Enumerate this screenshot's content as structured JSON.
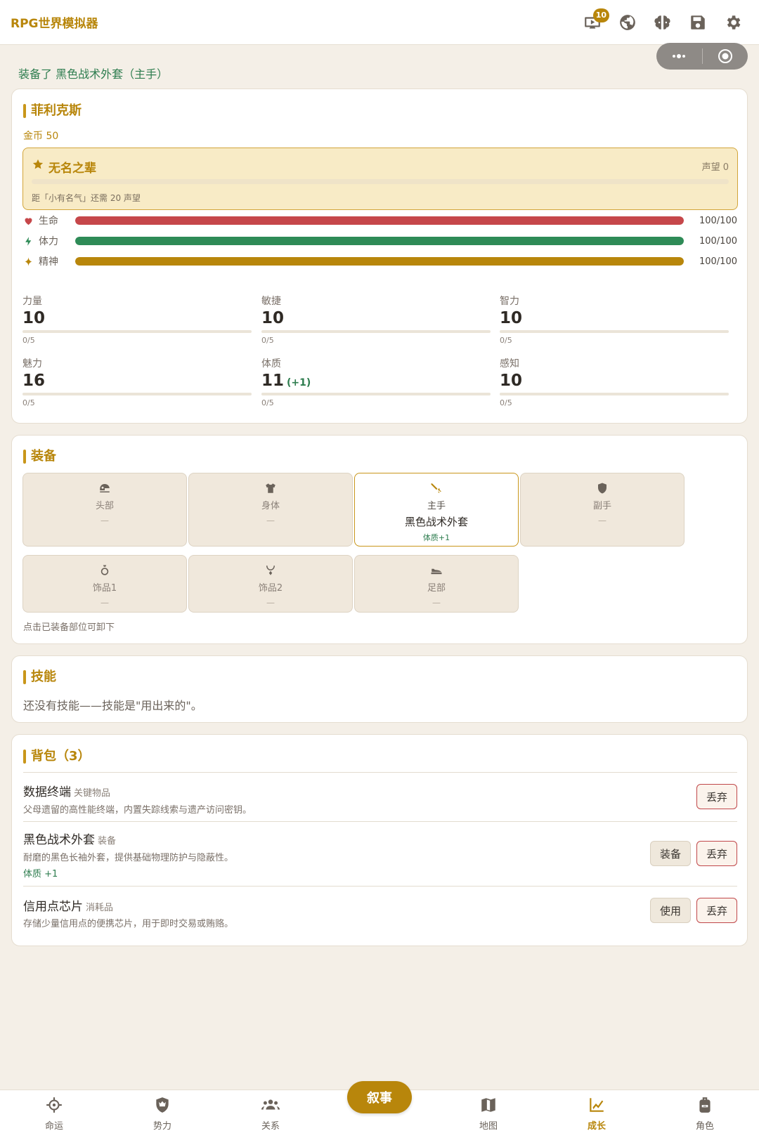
{
  "header": {
    "title": "RPG世界模拟器",
    "notification_count": "10",
    "icons": [
      "tv-icon",
      "globe-icon",
      "brain-icon",
      "save-icon",
      "gear-icon"
    ]
  },
  "notice": "装备了 黑色战术外套（主手）",
  "character": {
    "name": "菲利克斯",
    "gold": "金币 50",
    "fame": {
      "title": "无名之辈",
      "value": "声望 0",
      "progress": 0,
      "hint": "距「小有名气」还需 20 声望"
    },
    "vitals": [
      {
        "label": "生命",
        "value": "100/100",
        "fraction": 1.0,
        "color": "#c6474a",
        "icon": "heart-icon"
      },
      {
        "label": "体力",
        "value": "100/100",
        "fraction": 1.0,
        "color": "#2e8b57",
        "icon": "bolt-icon"
      },
      {
        "label": "精神",
        "value": "100/100",
        "fraction": 1.0,
        "color": "#b8860b",
        "icon": "sparkle-icon"
      }
    ],
    "stats": [
      {
        "label": "力量",
        "value": "10",
        "bonus": "",
        "progress": "0/5",
        "fraction": 0
      },
      {
        "label": "敏捷",
        "value": "10",
        "bonus": "",
        "progress": "0/5",
        "fraction": 0
      },
      {
        "label": "智力",
        "value": "10",
        "bonus": "",
        "progress": "0/5",
        "fraction": 0
      },
      {
        "label": "魅力",
        "value": "16",
        "bonus": "",
        "progress": "0/5",
        "fraction": 0
      },
      {
        "label": "体质",
        "value": "11",
        "bonus": "(+1)",
        "progress": "0/5",
        "fraction": 0
      },
      {
        "label": "感知",
        "value": "10",
        "bonus": "",
        "progress": "0/5",
        "fraction": 0
      }
    ]
  },
  "equipment": {
    "title": "装备",
    "hint": "点击已装备部位可卸下",
    "slots": [
      {
        "name": "头部",
        "item": "—",
        "bonus": "",
        "icon": "helmet-icon"
      },
      {
        "name": "身体",
        "item": "—",
        "bonus": "",
        "icon": "shirt-icon"
      },
      {
        "name": "主手",
        "item": "黑色战术外套",
        "bonus": "体质+1",
        "icon": "sword-icon"
      },
      {
        "name": "副手",
        "item": "—",
        "bonus": "",
        "icon": "shield-icon"
      },
      {
        "name": "饰品1",
        "item": "—",
        "bonus": "",
        "icon": "ring-icon"
      },
      {
        "name": "饰品2",
        "item": "—",
        "bonus": "",
        "icon": "necklace-icon"
      },
      {
        "name": "足部",
        "item": "—",
        "bonus": "",
        "icon": "shoe-icon"
      }
    ]
  },
  "skills": {
    "title": "技能",
    "empty": "还没有技能——技能是\"用出来的\"。"
  },
  "inventory": {
    "title": "背包（3）",
    "items": [
      {
        "name": "数据终端",
        "type": "关键物品",
        "desc": "父母遗留的高性能终端，内置失踪线索与遗产访问密钥。",
        "bonus": "",
        "actions": [
          "丢弃"
        ]
      },
      {
        "name": "黑色战术外套",
        "type": "装备",
        "desc": "耐磨的黑色长袖外套，提供基础物理防护与隐蔽性。",
        "bonus": "体质 +1",
        "actions": [
          "装备",
          "丢弃"
        ]
      },
      {
        "name": "信用点芯片",
        "type": "消耗品",
        "desc": "存储少量信用点的便携芯片，用于即时交易或贿赂。",
        "bonus": "",
        "actions": [
          "使用",
          "丢弃"
        ]
      }
    ]
  },
  "nav": {
    "center_label": "叙事",
    "active": "成长",
    "items": [
      {
        "label": "命运",
        "icon": "crosshair-icon"
      },
      {
        "label": "势力",
        "icon": "crown-shield-icon"
      },
      {
        "label": "关系",
        "icon": "people-icon"
      },
      {
        "label": "地图",
        "icon": "map-icon"
      },
      {
        "label": "成长",
        "icon": "growth-chart-icon"
      },
      {
        "label": "角色",
        "icon": "backpack-icon"
      }
    ]
  },
  "colors": {
    "accent": "#b8860b",
    "health": "#c6474a",
    "stamina": "#2e8b57",
    "spirit": "#b8860b",
    "bonus_green": "#2e7d4f",
    "danger": "#c0474a"
  }
}
